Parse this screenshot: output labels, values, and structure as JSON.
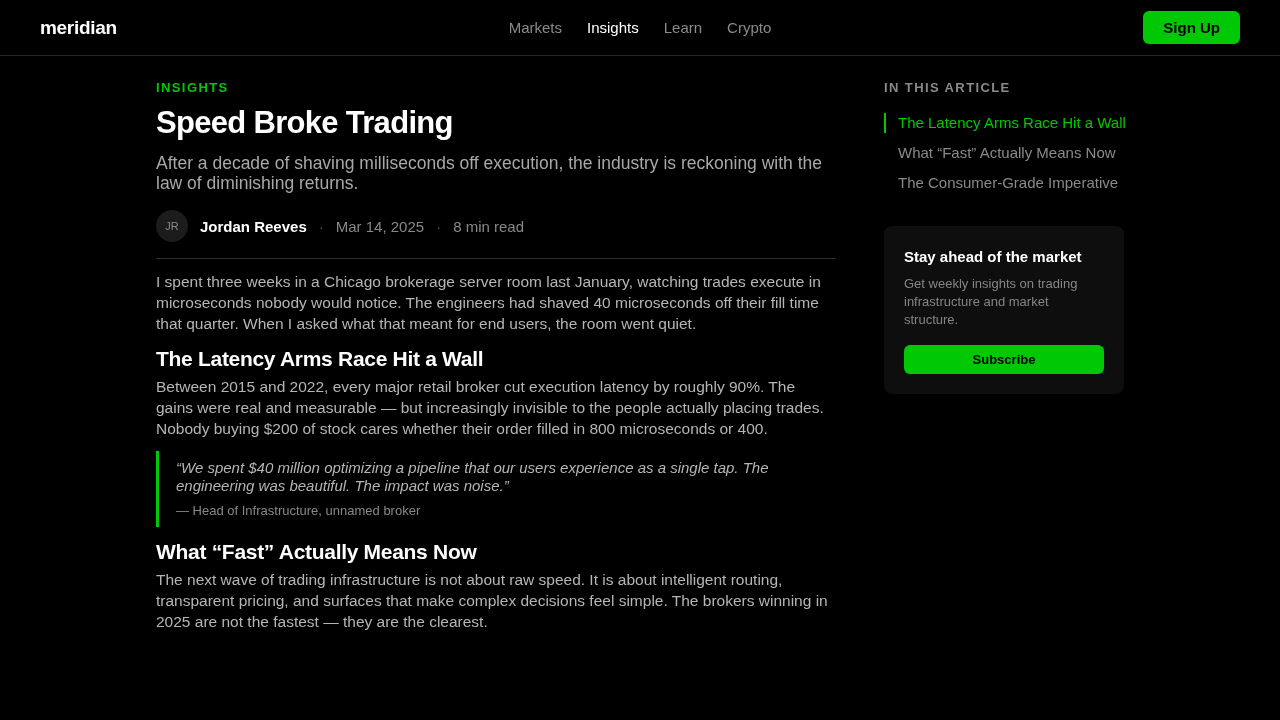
{
  "header": {
    "logo": "meridian",
    "nav": [
      {
        "label": "Markets",
        "selected": false
      },
      {
        "label": "Insights",
        "selected": true
      },
      {
        "label": "Learn",
        "selected": false
      },
      {
        "label": "Crypto",
        "selected": false
      }
    ],
    "cta": "Sign Up"
  },
  "article": {
    "category": "INSIGHTS",
    "title": "Speed Broke Trading",
    "subtitle": "After a decade of shaving milliseconds off execution, the industry is reckoning with the law of diminishing returns.",
    "avatar": "JR",
    "byline": [
      {
        "kind": "author",
        "text": "Jordan Reeves"
      },
      {
        "kind": "separator",
        "text": "·"
      },
      {
        "kind": "date",
        "text": "Mar 14, 2025"
      },
      {
        "kind": "separator",
        "text": "·"
      },
      {
        "kind": "read_time",
        "text": "8 min read"
      }
    ],
    "body": [
      {
        "kind": "paragraph",
        "text": "I spent three weeks in a Chicago brokerage server room last January, watching trades execute in microseconds nobody would notice. The engineers had shaved 40 microseconds off their fill time that quarter. When I asked what that meant for end users, the room went quiet."
      },
      {
        "kind": "heading",
        "text": "The Latency Arms Race Hit a Wall"
      },
      {
        "kind": "paragraph",
        "text": "Between 2015 and 2022, every major retail broker cut execution latency by roughly 90%. The gains were real and measurable — but increasingly invisible to the people actually placing trades. Nobody buying $200 of stock cares whether their order filled in 800 microseconds or 400."
      },
      {
        "kind": "quote",
        "text": "“We spent $40 million optimizing a pipeline that our users experience as a single tap. The engineering was beautiful. The impact was noise.”",
        "attribution": "— Head of Infrastructure, unnamed broker"
      },
      {
        "kind": "heading",
        "text": "What “Fast” Actually Means Now"
      },
      {
        "kind": "paragraph",
        "text": "The next wave of trading infrastructure is not about raw speed. It is about intelligent routing, transparent pricing, and surfaces that make complex decisions feel simple. The brokers winning in 2025 are not the fastest — they are the clearest."
      }
    ]
  },
  "sidebar": {
    "toc_title": "IN THIS ARTICLE",
    "toc": [
      {
        "label": "The Latency Arms Race Hit a Wall",
        "selected": true
      },
      {
        "label": "What “Fast” Actually Means Now",
        "selected": false
      },
      {
        "label": "The Consumer-Grade Imperative",
        "selected": false
      }
    ],
    "newsletter": {
      "title": "Stay ahead of the market",
      "description": "Get weekly insights on trading infrastructure and market structure.",
      "button": "Subscribe"
    }
  }
}
